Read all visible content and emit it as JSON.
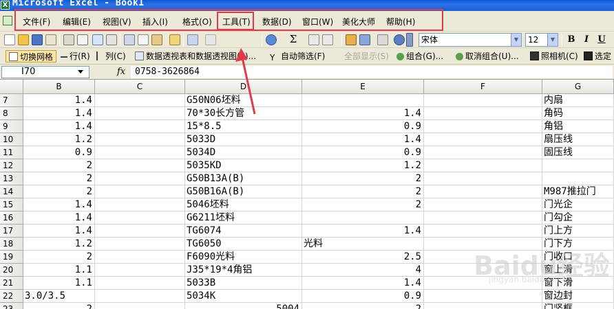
{
  "window": {
    "title": "Microsoft Excel - Book1",
    "app_icon": "excel-icon"
  },
  "menu": {
    "items": [
      {
        "label": "文件(F)"
      },
      {
        "label": "编辑(E)"
      },
      {
        "label": "视图(V)"
      },
      {
        "label": "插入(I)"
      },
      {
        "label": "格式(O)"
      },
      {
        "label": "工具(T)"
      },
      {
        "label": "数据(D)"
      },
      {
        "label": "窗口(W)"
      },
      {
        "label": "美化大师"
      },
      {
        "label": "帮助(H)"
      }
    ]
  },
  "toolbar": {
    "font_name": "宋体",
    "font_size": "12",
    "bold": "B",
    "italic": "I",
    "underline": "U",
    "sigma": "Σ"
  },
  "toolbar2": {
    "switch_grid": "切换网格",
    "row": "行(R)",
    "col": "列(C)",
    "pivot": "数据透视表和数据透视图(P)...",
    "autofilter": "自动筛选(F)",
    "show_all": "全部显示(S)",
    "group": "组合(G)...",
    "ungroup": "取消组合(U)...",
    "camera": "照相机(C)",
    "select": "选定"
  },
  "formula_bar": {
    "name_box": "I70",
    "fx": "fx",
    "formula": "0758-3626864"
  },
  "columns": [
    "B",
    "C",
    "D",
    "E",
    "F",
    "G"
  ],
  "rows": [
    {
      "num": "7",
      "B": "1.4",
      "C": "",
      "D": "G50N06坯料",
      "E": "",
      "F": "",
      "G": "内扇"
    },
    {
      "num": "8",
      "B": "1.4",
      "C": "",
      "D": "70*30长方管",
      "E": "1.4",
      "F": "",
      "G": "角码"
    },
    {
      "num": "9",
      "B": "1.4",
      "C": "",
      "D": "15*8.5",
      "E": "0.9",
      "F": "",
      "G": "角铝"
    },
    {
      "num": "10",
      "B": "1.2",
      "C": "",
      "D": "5033D",
      "E": "1.4",
      "F": "",
      "G": "扇压线"
    },
    {
      "num": "11",
      "B": "0.9",
      "C": "",
      "D": "5034D",
      "E": "0.9",
      "F": "",
      "G": "固压线"
    },
    {
      "num": "12",
      "B": "2",
      "C": "",
      "D": "5035KD",
      "E": "1.2",
      "F": "",
      "G": ""
    },
    {
      "num": "13",
      "B": "2",
      "C": "",
      "D": "G50B13A(B)",
      "E": "2",
      "F": "",
      "G": ""
    },
    {
      "num": "14",
      "B": "2",
      "C": "",
      "D": "G50B16A(B)",
      "E": "2",
      "F": "",
      "G": "M987推拉门"
    },
    {
      "num": "15",
      "B": "1.4",
      "C": "",
      "D": "5046坯料",
      "E": "2",
      "F": "",
      "G": "门光企"
    },
    {
      "num": "16",
      "B": "1.4",
      "C": "",
      "D": "G6211坯料",
      "E": "",
      "F": "",
      "G": "门勾企"
    },
    {
      "num": "17",
      "B": "1.4",
      "C": "",
      "D": "TG6074",
      "E": "1.4",
      "F": "",
      "G": "门上方"
    },
    {
      "num": "18",
      "B": "1.2",
      "C": "",
      "D": "TG6050",
      "E": "光料",
      "F": "",
      "G": "门下方"
    },
    {
      "num": "19",
      "B": "2",
      "C": "",
      "D": "F6090光料",
      "E": "2.5",
      "F": "",
      "G": "门收口"
    },
    {
      "num": "20",
      "B": "1.1",
      "C": "",
      "D": "J35*19*4角铝",
      "E": "4",
      "F": "",
      "G": "窗上滑"
    },
    {
      "num": "21",
      "B": "1.1",
      "C": "",
      "D": "5033B",
      "E": "1.4",
      "F": "",
      "G": "窗下滑"
    },
    {
      "num": "22",
      "B": "3.0/3.5",
      "C": "",
      "D": "5034K",
      "E": "0.9",
      "F": "",
      "G": "窗边封"
    },
    {
      "num": "23",
      "B": "2",
      "C": "",
      "D": "5004",
      "E": "2",
      "F": "",
      "G": "门竖框"
    }
  ],
  "watermark": {
    "logo": "Baidu经验",
    "url": "jingyan.baidu.com"
  },
  "annotation_color": "#e03b47"
}
